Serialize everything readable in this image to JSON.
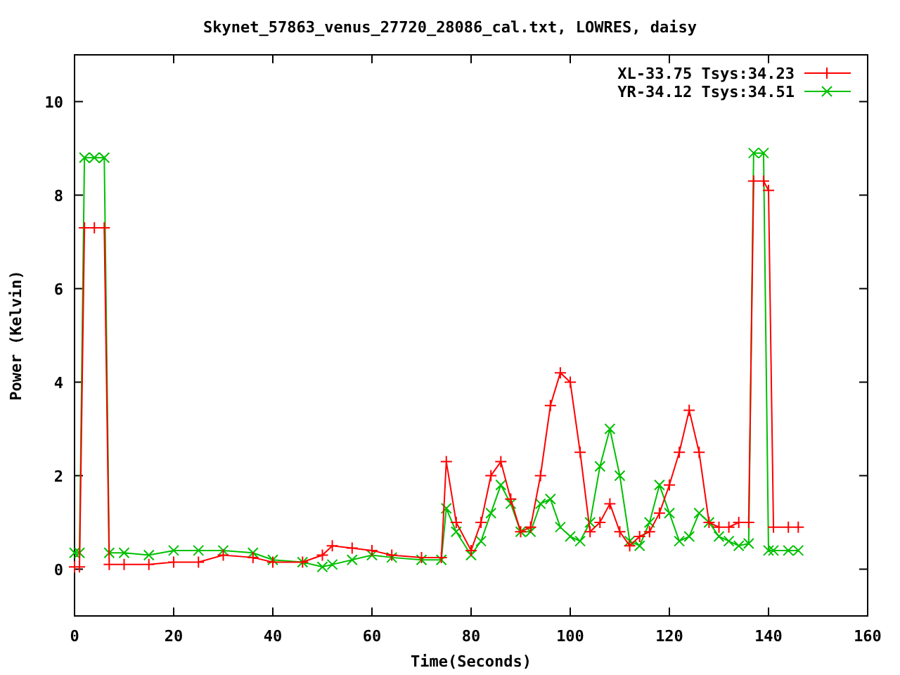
{
  "chart_data": {
    "type": "line",
    "title": "Skynet_57863_venus_27720_28086_cal.txt, LOWRES, daisy",
    "xlabel": "Time(Seconds)",
    "ylabel": "Power (Kelvin)",
    "x": [
      0,
      1,
      2,
      4,
      6,
      7,
      10,
      15,
      20,
      25,
      30,
      36,
      40,
      46,
      50,
      52,
      56,
      60,
      64,
      70,
      74,
      75,
      77,
      80,
      82,
      84,
      86,
      88,
      90,
      92,
      94,
      96,
      98,
      100,
      102,
      104,
      106,
      108,
      110,
      112,
      114,
      116,
      118,
      120,
      122,
      124,
      126,
      128,
      130,
      132,
      134,
      136,
      137,
      139,
      140,
      141,
      144,
      146
    ],
    "series": [
      {
        "name": "XL-33.75 Tsys:34.23",
        "color": "#ff0000",
        "marker": "plus",
        "values": [
          0.05,
          0.05,
          7.3,
          7.3,
          7.3,
          0.1,
          0.1,
          0.1,
          0.15,
          0.15,
          0.3,
          0.25,
          0.15,
          0.15,
          0.3,
          0.5,
          0.45,
          0.4,
          0.3,
          0.25,
          0.25,
          2.3,
          1.0,
          0.4,
          1.0,
          2.0,
          2.3,
          1.5,
          0.8,
          0.9,
          2.0,
          3.5,
          4.2,
          4.0,
          2.5,
          0.8,
          1.0,
          1.4,
          0.8,
          0.5,
          0.7,
          0.8,
          1.2,
          1.8,
          2.5,
          3.4,
          2.5,
          1.0,
          0.9,
          0.9,
          1.0,
          1.0,
          8.3,
          8.3,
          8.1,
          0.9,
          0.9,
          0.9
        ]
      },
      {
        "name": "YR-34.12 Tsys:34.51",
        "color": "#00c000",
        "marker": "cross",
        "values": [
          0.35,
          0.35,
          8.8,
          8.8,
          8.8,
          0.35,
          0.35,
          0.3,
          0.4,
          0.4,
          0.4,
          0.35,
          0.2,
          0.15,
          0.05,
          0.1,
          0.2,
          0.3,
          0.25,
          0.2,
          0.2,
          1.3,
          0.8,
          0.3,
          0.6,
          1.2,
          1.8,
          1.4,
          0.8,
          0.8,
          1.4,
          1.5,
          0.9,
          0.7,
          0.6,
          1.0,
          2.2,
          3.0,
          2.0,
          0.6,
          0.5,
          1.0,
          1.8,
          1.2,
          0.6,
          0.7,
          1.2,
          1.0,
          0.7,
          0.6,
          0.5,
          0.55,
          8.9,
          8.9,
          0.4,
          0.4,
          0.4,
          0.4
        ]
      }
    ],
    "legend": true,
    "xlim": [
      0,
      160
    ],
    "ylim": [
      -1,
      11
    ],
    "xticks": [
      0,
      20,
      40,
      60,
      80,
      100,
      120,
      140,
      160
    ],
    "yticks": [
      0,
      2,
      4,
      6,
      8,
      10
    ]
  }
}
